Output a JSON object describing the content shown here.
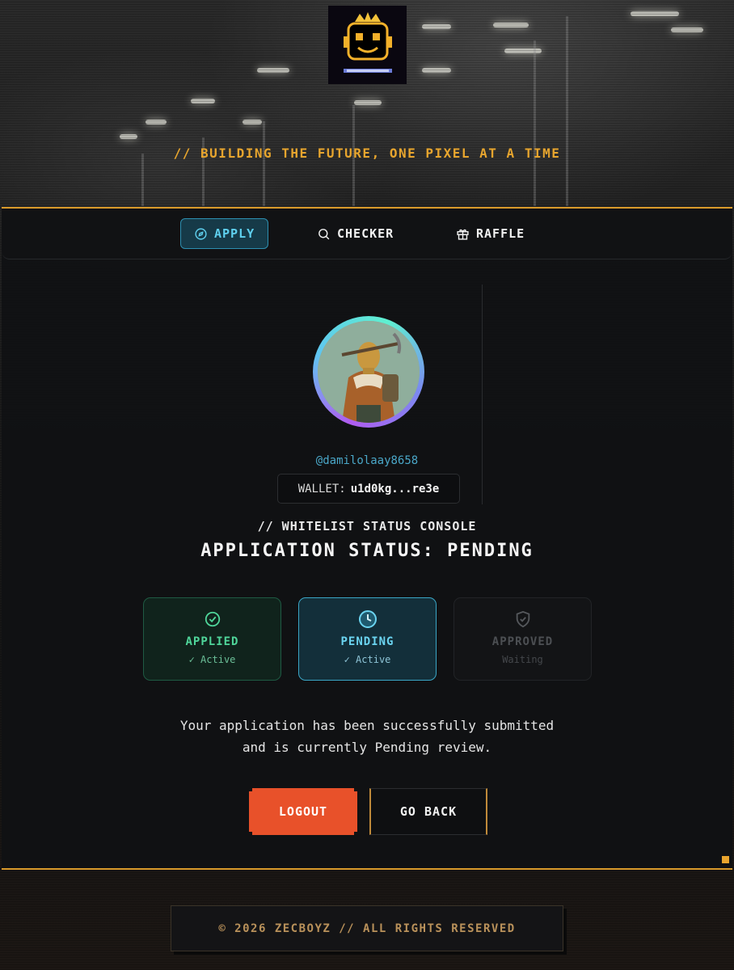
{
  "header": {
    "logo_icon": "crowned-robot-logo",
    "tagline": "// BUILDING THE FUTURE, ONE PIXEL AT A TIME"
  },
  "nav": {
    "tabs": [
      {
        "label": "APPLY",
        "icon": "compass-icon",
        "active": true
      },
      {
        "label": "CHECKER",
        "icon": "search-icon",
        "active": false
      },
      {
        "label": "RAFFLE",
        "icon": "gift-icon",
        "active": false
      }
    ]
  },
  "profile": {
    "username": "@damilolaay8658",
    "wallet_label": "WALLET:",
    "wallet_value": "u1d0kg...re3e"
  },
  "console": {
    "label": "// WHITELIST STATUS CONSOLE",
    "status_title": "APPLICATION STATUS: PENDING"
  },
  "steps": [
    {
      "title": "APPLIED",
      "sub": "✓ Active",
      "icon": "check-circle-icon"
    },
    {
      "title": "PENDING",
      "sub": "✓ Active",
      "icon": "clock-icon"
    },
    {
      "title": "APPROVED",
      "sub": "Waiting",
      "icon": "shield-check-icon"
    }
  ],
  "message": {
    "line1": "Your application has been successfully submitted",
    "line2": "and is currently Pending review."
  },
  "actions": {
    "logout_label": "LOGOUT",
    "back_label": "GO BACK"
  },
  "footer": {
    "text": "© 2026 ZECBOYZ // ALL RIGHTS RESERVED"
  },
  "colors": {
    "accent_orange": "#d99a2b",
    "active_cyan": "#5fd0ee",
    "applied_green": "#4fd59a",
    "logout_red": "#e8512a"
  }
}
